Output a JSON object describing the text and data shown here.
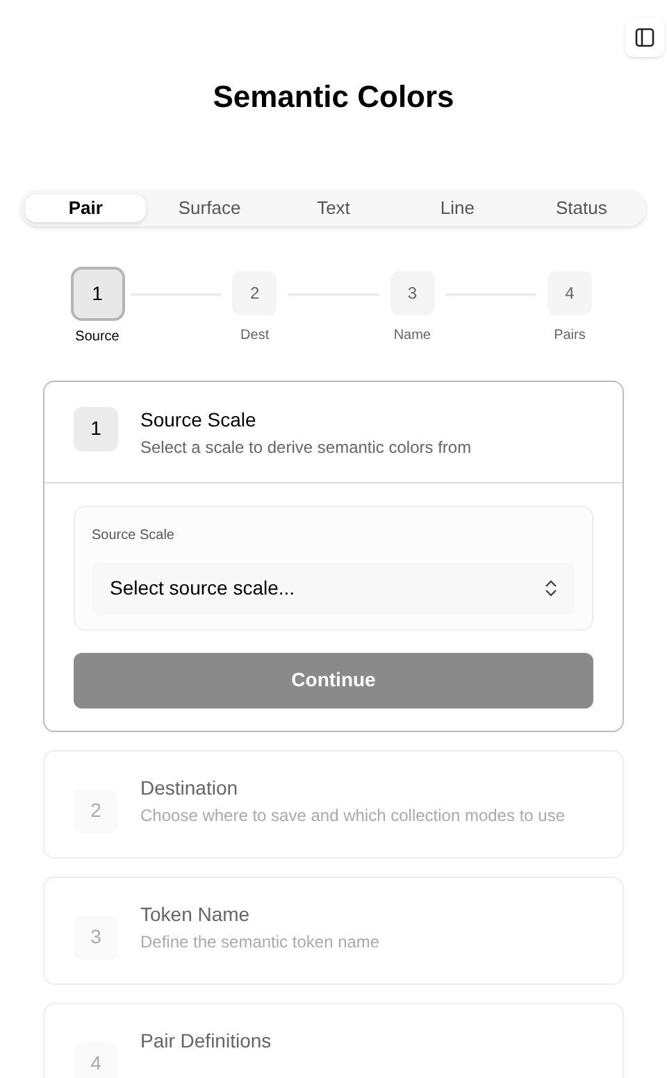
{
  "title": "Semantic Colors",
  "tabs": [
    {
      "label": "Pair",
      "selected": true
    },
    {
      "label": "Surface",
      "selected": false
    },
    {
      "label": "Text",
      "selected": false
    },
    {
      "label": "Line",
      "selected": false
    },
    {
      "label": "Status",
      "selected": false
    }
  ],
  "stepper": [
    {
      "number": "1",
      "label": "Source",
      "active": true
    },
    {
      "number": "2",
      "label": "Dest",
      "active": false
    },
    {
      "number": "3",
      "label": "Name",
      "active": false
    },
    {
      "number": "4",
      "label": "Pairs",
      "active": false
    }
  ],
  "cards": [
    {
      "number": "1",
      "title": "Source Scale",
      "description": "Select a scale to derive semantic colors from",
      "expanded": true,
      "field": {
        "label": "Source Scale",
        "placeholder": "Select source scale..."
      },
      "button": "Continue"
    },
    {
      "number": "2",
      "title": "Destination",
      "description": "Choose where to save and which collection modes to use",
      "expanded": false
    },
    {
      "number": "3",
      "title": "Token Name",
      "description": "Define the semantic token name",
      "expanded": false
    },
    {
      "number": "4",
      "title": "Pair Definitions",
      "expanded": false
    }
  ]
}
